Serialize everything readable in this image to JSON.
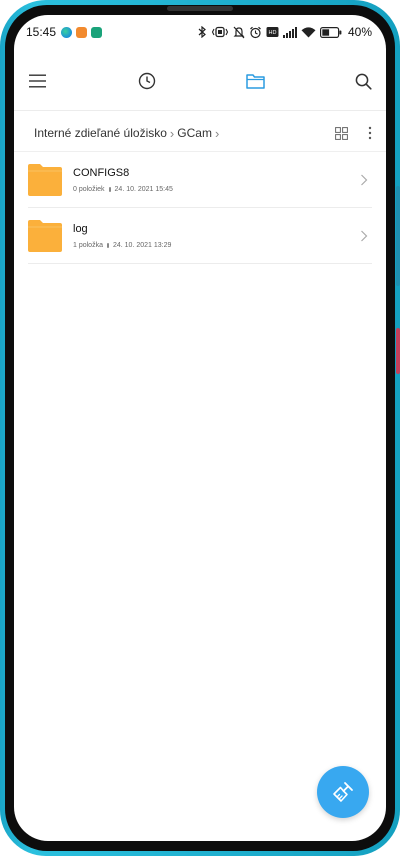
{
  "status_bar": {
    "time": "15:45",
    "app_icons": [
      "edge-icon",
      "shop-icon",
      "app-icon"
    ],
    "battery": "40%",
    "icons": [
      "bluetooth-icon",
      "vibrate-icon",
      "mute-icon",
      "alarm-icon",
      "volte-icon",
      "signal-icon",
      "wifi-icon",
      "battery-icon"
    ]
  },
  "toolbar": {
    "menu_icon": "menu-icon",
    "recent_icon": "clock-icon",
    "files_icon": "folder-icon",
    "search_icon": "search-icon",
    "accent": "#2a9be0"
  },
  "breadcrumb": {
    "items": [
      "Interné zdieľané úložisko",
      "GCam"
    ]
  },
  "files": [
    {
      "name": "CONFIGS8",
      "count": "0 položiek",
      "date": "24. 10. 2021 15:45"
    },
    {
      "name": "log",
      "count": "1 položka",
      "date": "24. 10. 2021 13:29"
    }
  ],
  "colors": {
    "folder": "#fbb03b",
    "fab": "#38a8f0",
    "frame": "#1aa6c8"
  },
  "fab": {
    "icon": "clean-brush-icon"
  }
}
